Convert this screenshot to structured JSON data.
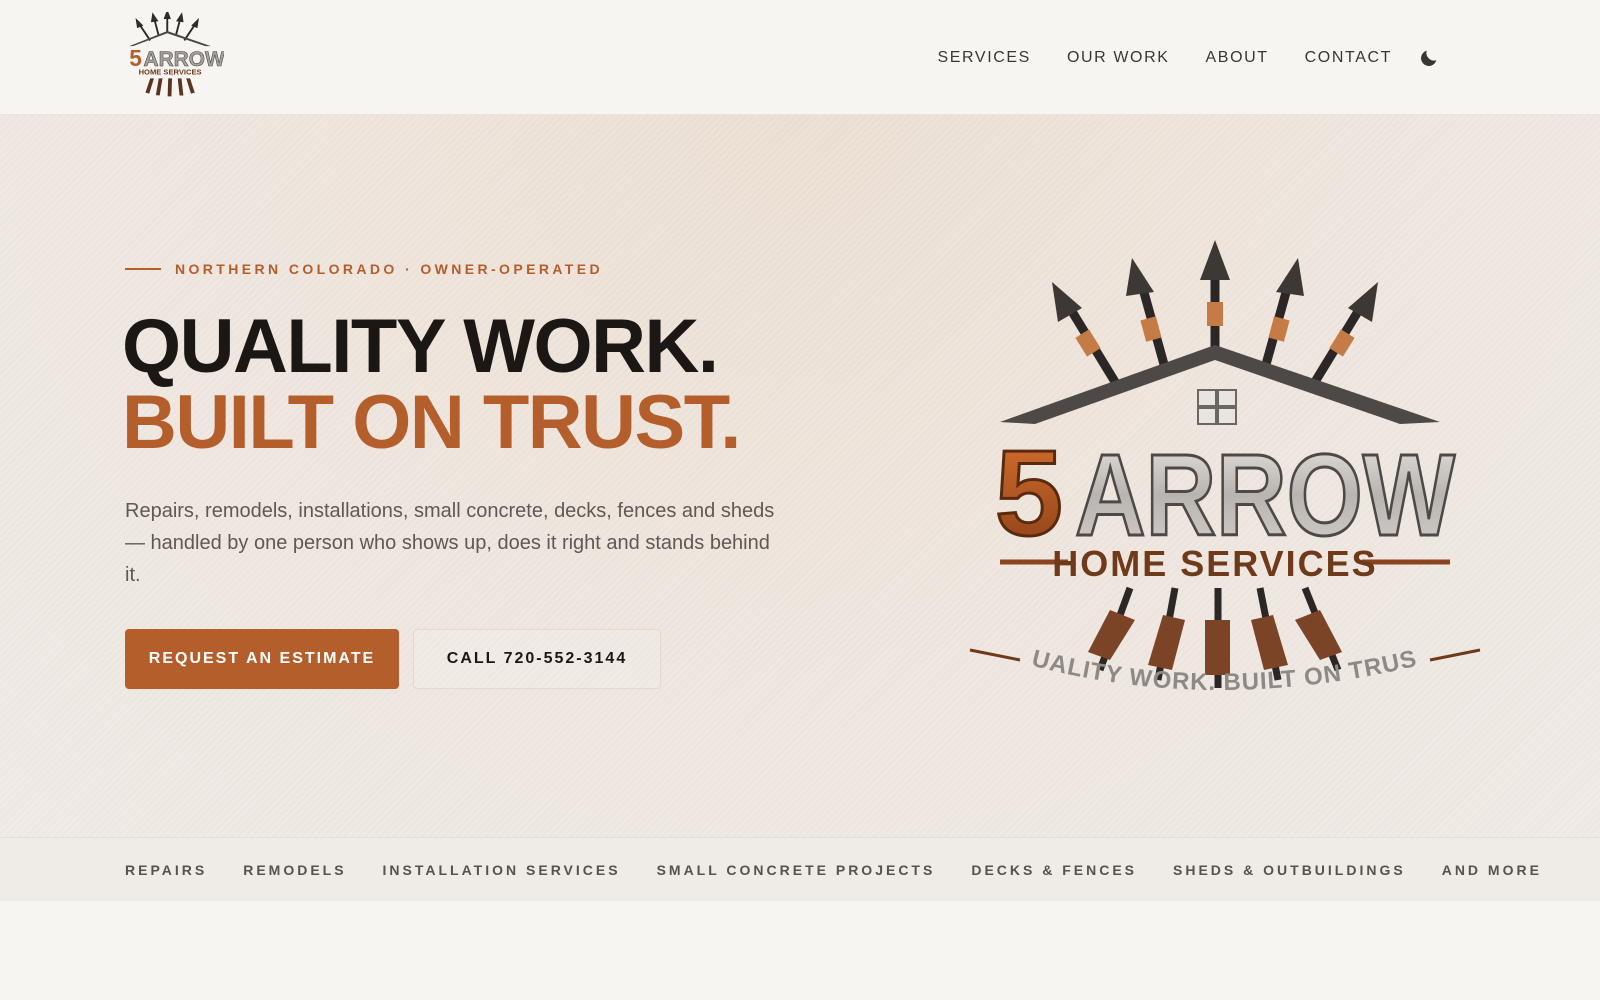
{
  "brand": {
    "logo_number": "5",
    "logo_word": "ARROW",
    "logo_sub": "HOME SERVICES",
    "logo_tagline": "QUALITY WORK. BUILT ON TRUST."
  },
  "nav": {
    "items": [
      {
        "label": "SERVICES"
      },
      {
        "label": "OUR WORK"
      },
      {
        "label": "ABOUT"
      },
      {
        "label": "CONTACT"
      }
    ],
    "theme_toggle_icon": "moon-icon"
  },
  "hero": {
    "eyebrow": "NORTHERN COLORADO · OWNER-OPERATED",
    "headline_line1": "QUALITY WORK.",
    "headline_line2": "BUILT ON TRUST.",
    "subtext": "Repairs, remodels, installations, small concrete, decks, fences and sheds — handled by one person who shows up, does it right and stands behind it.",
    "cta_primary": "REQUEST AN ESTIMATE",
    "cta_secondary": "CALL 720-552-3144"
  },
  "services_strip": {
    "items": [
      "REPAIRS",
      "REMODELS",
      "INSTALLATION SERVICES",
      "SMALL CONCRETE PROJECTS",
      "DECKS & FENCES",
      "SHEDS & OUTBUILDINGS",
      "AND MORE"
    ]
  },
  "colors": {
    "accent": "#b45e2c",
    "text_dark": "#1b1714",
    "text_muted": "#5f5853",
    "background": "#f7f5f2"
  }
}
